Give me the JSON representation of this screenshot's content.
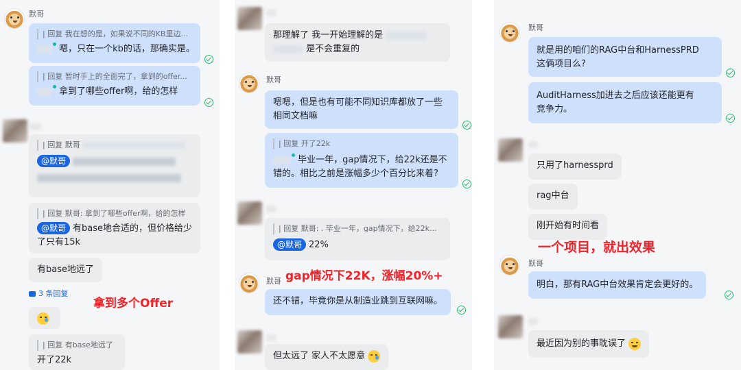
{
  "panel1": {
    "sender": "默哥",
    "msg1_quote": "| 回复 我在想的是，如果说不同的KB里边...",
    "msg1_text": "嗯，只在一个kb的话，那确实是。",
    "msg2_quote": "| 回复 暂时手上的全面完了，拿到的offer...",
    "msg2_text": "拿到了哪些offer啊，给的怎样",
    "msg3_quote": "| 回复 默哥",
    "msg3_mention": "@默哥",
    "msg4_quote": "| 回复 默哥: 拿到了哪些offer啊，给的怎样",
    "msg4_mention": "@默哥",
    "msg4_text_1": "有base地合适的，但价格给少",
    "msg4_text_2": "了只有15k",
    "msg5_text": "有base地远了",
    "replies": "3 条回复",
    "annotation": "拿到多个Offer",
    "msg7_quote": "| 回复 有base地远了",
    "msg7_text": "开了22k"
  },
  "panel2": {
    "msg1_line1": "那理解了 我一开始理解的是",
    "msg1_line2": "是不会重复的",
    "sender": "默哥",
    "msg2_line1": "嗯嗯，但是也有可能不同知识库都放了一些",
    "msg2_line2": "相同文档嘛",
    "msg3_quote": "| 回复 开了22k",
    "msg3_line1": "毕业一年，gap情况下，给22k还是不",
    "msg3_line2": "错的。相比之前是涨幅多少个百分比来着?",
    "msg4_quote": "| 回复 默哥: . 毕业一年，gap情况下，给22k...",
    "msg4_mention": "@默哥",
    "msg4_text": "22%",
    "sender2": "默哥",
    "annotation": "gap情况下22K，涨幅20%+",
    "msg5_text": "还不错，毕竟你是从制造业跳到互联网嘛。",
    "msg6_text": "但太远了 家人不太愿意"
  },
  "panel3": {
    "sender": "默哥",
    "msg1_line1": "就是用的咱们的RAG中台和HarnessPRD",
    "msg1_line2": "这俩项目么?",
    "msg2_line1": "AuditHarness加进去之后应该还能更有",
    "msg2_line2": "竞争力。",
    "msg3_text": "只用了harnessprd",
    "msg4_text": "rag中台",
    "msg5_text": "刚开始有时间看",
    "annotation": "一个项目，就出效果",
    "sender2": "默哥",
    "msg6_text": "明白，那有RAG中台效果肯定会更好的。",
    "msg7_text": "最近因为别的事耽误了"
  },
  "colors": {
    "my_bubble": "#cfe0fd",
    "other_bubble": "#ebeced",
    "read_check": "#2fb56b",
    "annotation": "#f0232a",
    "mention": "#1b66e0"
  },
  "icons": [
    "dog-avatar-icon",
    "read-check-icon",
    "reply-thread-icon",
    "laugh-cry-emoji-icon",
    "thinking-emoji-icon"
  ]
}
